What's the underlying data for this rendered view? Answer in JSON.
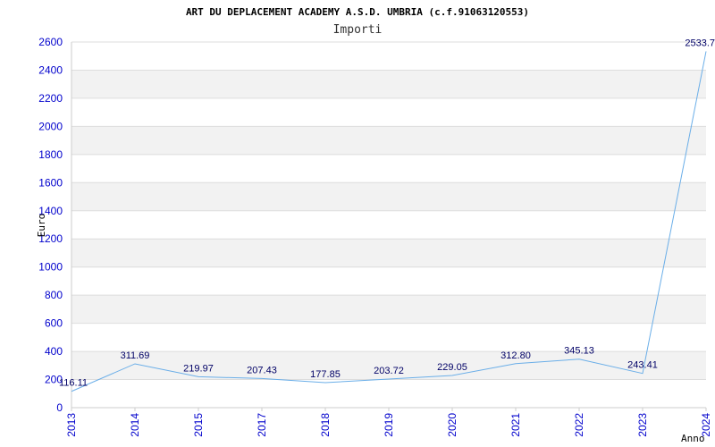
{
  "chart_data": {
    "type": "line",
    "title": "ART DU DEPLACEMENT ACADEMY A.S.D. UMBRIA (c.f.91063120553)",
    "subtitle": "Importi",
    "xlabel": "Anno",
    "ylabel": "Euro",
    "categories": [
      "2013",
      "2014",
      "2015",
      "2017",
      "2018",
      "2019",
      "2020",
      "2021",
      "2022",
      "2023",
      "2024"
    ],
    "values": [
      116.11,
      311.69,
      219.97,
      207.43,
      177.85,
      203.72,
      229.05,
      312.8,
      345.13,
      243.41,
      2533.7
    ],
    "value_labels": [
      "116.11",
      "311.69",
      "219.97",
      "207.43",
      "177.85",
      "203.72",
      "229.05",
      "312.80",
      "345.13",
      "243.41",
      "2533.7"
    ],
    "yticks": [
      "0",
      "200",
      "400",
      "600",
      "800",
      "1000",
      "1200",
      "1400",
      "1600",
      "1800",
      "2000",
      "2200",
      "2400",
      "2600"
    ],
    "ylim": [
      0,
      2600
    ],
    "grid": true,
    "line_color": "#6aaee8",
    "band_color": "#f2f2f2"
  }
}
